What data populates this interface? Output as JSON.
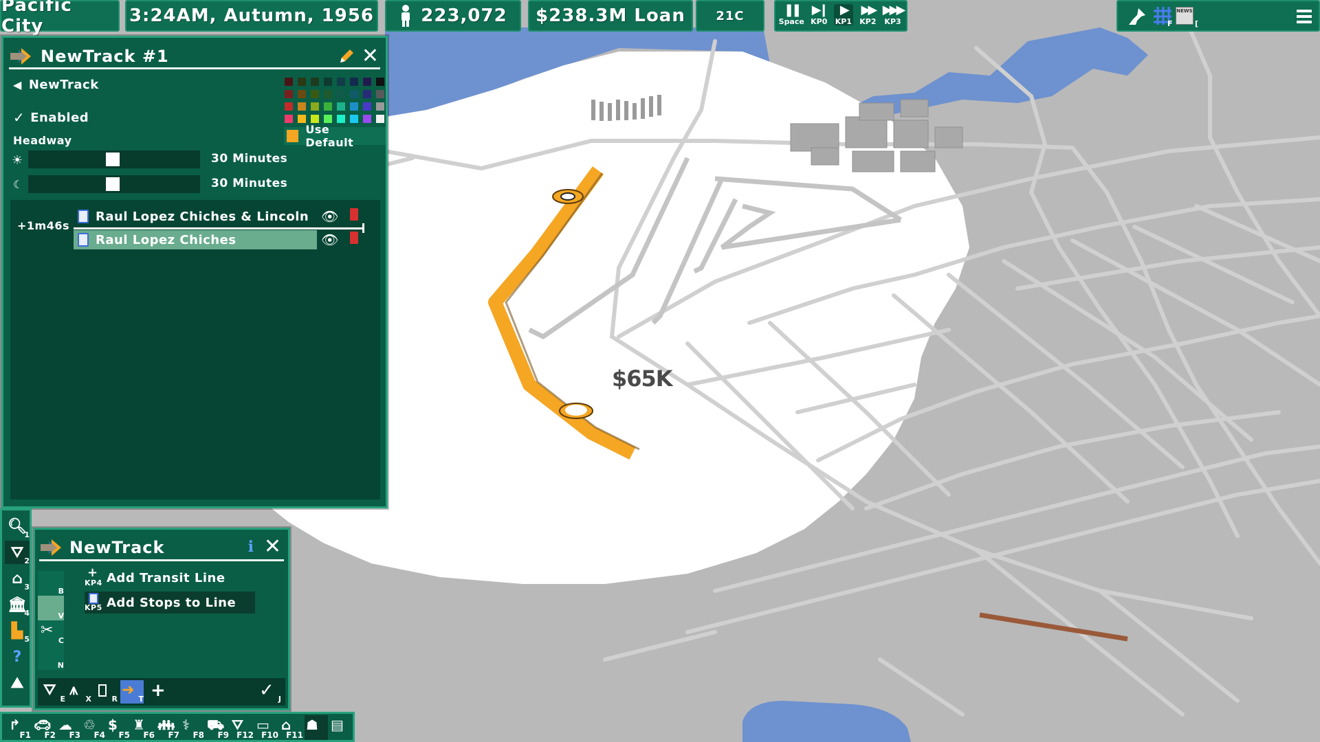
{
  "hud": {
    "city": "Pacific City",
    "time": "3:24AM, Autumn, 1956",
    "population": "223,072",
    "loan": "$238.3M Loan",
    "temperature": "21C",
    "speed": [
      {
        "key": "Space",
        "icon": "pause-icon"
      },
      {
        "key": "KP0",
        "icon": "step-icon"
      },
      {
        "key": "KP1",
        "icon": "play-icon"
      },
      {
        "key": "KP2",
        "icon": "fast-icon"
      },
      {
        "key": "KP3",
        "icon": "fastest-icon"
      }
    ],
    "tools": {
      "pin": "pin-icon",
      "grid_key": "F",
      "news": "NEWS",
      "news_key": "[",
      "menu": "menu-icon"
    }
  },
  "map": {
    "land_value_label": "$65K",
    "colors": {
      "water": "#6e91cf",
      "land": "#b8b8b8",
      "coverage": "#ffffff",
      "route": "#f5a623",
      "road": "#cfcfcf"
    }
  },
  "line_panel": {
    "title": "NewTrack #1",
    "back_label": "NewTrack",
    "enabled_label": "Enabled",
    "headway_label": "Headway",
    "day_headway": "30 Minutes",
    "night_headway": "30 Minutes",
    "day_slider_value": 0.5,
    "night_slider_value": 0.5,
    "use_default_label": "Use Default",
    "use_default_color": "#f5a623",
    "swatches": [
      "#4a1414",
      "#2a3a14",
      "#1e3a1e",
      "#0f3a30",
      "#123c48",
      "#122a4e",
      "#221a4e",
      "#111111",
      "#7a1f1f",
      "#6a4a12",
      "#3a5a12",
      "#1e5a2e",
      "#125a4a",
      "#125a6a",
      "#2a2a7a",
      "#5a5a5a",
      "#c42a2a",
      "#c9841c",
      "#8aa91c",
      "#3bb13b",
      "#1cb18a",
      "#1c8fc9",
      "#4a3ac9",
      "#9a9a9a",
      "#f03a6e",
      "#f5b81c",
      "#c9e81c",
      "#5af05a",
      "#1cf0c9",
      "#1cc9f0",
      "#9a4af0",
      "#f0f0f0"
    ],
    "travel_time": "+1m46s",
    "stops": [
      {
        "name": "Raul Lopez Chiches & Lincoln",
        "selected": false
      },
      {
        "name": "Raul Lopez Chiches",
        "selected": true
      }
    ]
  },
  "side_toolbar": [
    {
      "icon": "magnifier-icon",
      "key": "1"
    },
    {
      "icon": "road-icon",
      "key": "2"
    },
    {
      "icon": "zone-house-icon",
      "key": "3"
    },
    {
      "icon": "building-icon",
      "key": "4"
    },
    {
      "icon": "bulldozer-icon",
      "key": "5"
    },
    {
      "icon": "help-icon",
      "key": ""
    },
    {
      "icon": "terrain-icon",
      "key": ""
    }
  ],
  "tool_panel": {
    "title": "NewTrack",
    "tool_keys": [
      "B",
      "V",
      "C",
      "N"
    ],
    "options": [
      {
        "label": "Add Transit Line",
        "key": "KP4",
        "selected": false
      },
      {
        "label": "Add Stops to Line",
        "key": "KP5",
        "selected": true
      }
    ],
    "footer": [
      {
        "icon": "road-icon",
        "key": "E"
      },
      {
        "icon": "expressway-icon",
        "key": "X"
      },
      {
        "icon": "bus-icon",
        "key": "R"
      },
      {
        "icon": "transit-icon",
        "key": "T"
      },
      {
        "icon": "plus-icon",
        "key": ""
      }
    ],
    "confirm_key": "J"
  },
  "fkeys": [
    {
      "icon": "road-tool-icon",
      "key": "F1"
    },
    {
      "icon": "car-icon",
      "key": "F2"
    },
    {
      "icon": "cloud-icon",
      "key": "F3"
    },
    {
      "icon": "recycle-icon",
      "key": "F4"
    },
    {
      "icon": "money-icon",
      "key": "F5"
    },
    {
      "icon": "tower-icon",
      "key": "F6"
    },
    {
      "icon": "people-icon",
      "key": "F7"
    },
    {
      "icon": "health-icon",
      "key": "F8"
    },
    {
      "icon": "traffic-icon",
      "key": "F9"
    },
    {
      "icon": "roads-icon",
      "key": "F12"
    },
    {
      "icon": "bus-stop-icon",
      "key": "F10"
    },
    {
      "icon": "house-icon",
      "key": "F11"
    },
    {
      "icon": "landvalue-icon",
      "key": ""
    },
    {
      "icon": "list-icon",
      "key": ""
    }
  ]
}
